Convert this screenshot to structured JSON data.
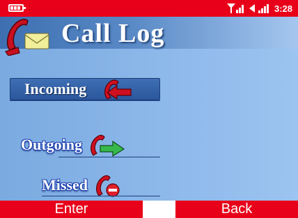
{
  "status_bar": {
    "time": "3:28",
    "icons": [
      "battery-icon",
      "signal-bars-icon",
      "speaker-signal-icon"
    ]
  },
  "header": {
    "title": "Call Log",
    "icon": "phone-envelope-icon"
  },
  "menu": {
    "items": [
      {
        "label": "Incoming",
        "icon": "phone-incoming-arrow-icon",
        "selected": true
      },
      {
        "label": "Outgoing",
        "icon": "phone-outgoing-arrow-icon",
        "selected": false
      },
      {
        "label": "Missed",
        "icon": "phone-missed-icon",
        "selected": false
      }
    ]
  },
  "softkeys": {
    "left": "Enter",
    "right": "Back"
  },
  "colors": {
    "status_bar": "#e8001a",
    "softkey": "#e8001a",
    "title_bar": "#3d6fb1",
    "background": "#8db8ea",
    "selection": "#2b569c",
    "incoming_arrow": "#d01020",
    "outgoing_arrow": "#36b84a"
  }
}
